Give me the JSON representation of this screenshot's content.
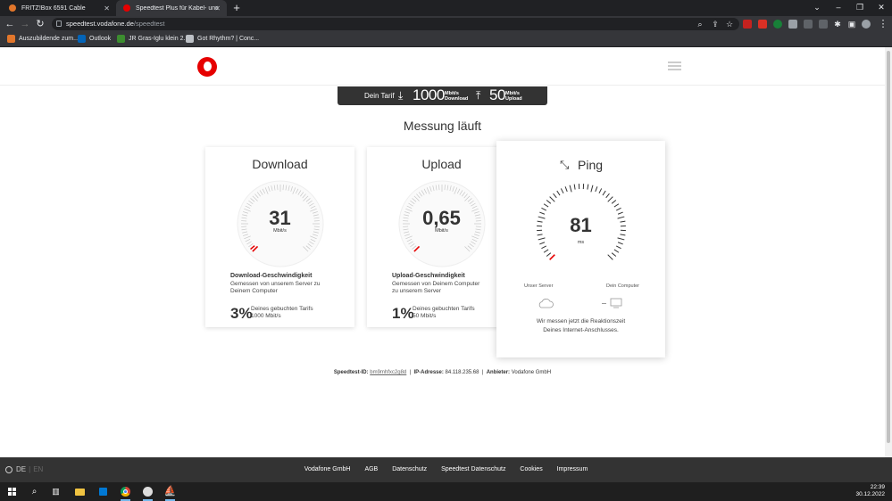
{
  "browser": {
    "tabs": [
      {
        "title": "FRITZ!Box 6591 Cable"
      },
      {
        "title": "Speedtest Plus für Kabel- und DS"
      }
    ],
    "url_host": "speedtest.vodafone.de",
    "url_path": "/speedtest",
    "bookmarks": [
      {
        "label": "Auszubildende zum..."
      },
      {
        "label": "Outlook"
      },
      {
        "label": "JR Gras-Iglu klein 2..."
      },
      {
        "label": "Got Rhythm? | Conc..."
      }
    ]
  },
  "tarif": {
    "label": "Dein Tarif",
    "download_value": "1000",
    "download_unit_1": "Mbit/s",
    "download_unit_2": "Download",
    "upload_value": "50",
    "upload_unit_1": "Mbit/s",
    "upload_unit_2": "Upload"
  },
  "status_text": "Messung läuft",
  "download": {
    "title": "Download",
    "value": "31",
    "unit": "Mbit/s",
    "desc_title": "Download-Geschwindigkeit",
    "desc_text": "Gemessen von unserem Server zu Deinem Computer",
    "percent": "3%",
    "pct_line1": "Deines gebuchten Tarifs",
    "pct_line2": "1000 Mbit/s",
    "fraction": 0.03
  },
  "upload": {
    "title": "Upload",
    "value": "0,65",
    "unit": "Mbit/s",
    "desc_title": "Upload-Geschwindigkeit",
    "desc_text": "Gemessen von Deinem Computer zu unserem Server",
    "percent": "1%",
    "pct_line1": "Deines gebuchten Tarifs",
    "pct_line2": "50 Mbit/s",
    "fraction": 0.01
  },
  "ping": {
    "title": "Ping",
    "value": "81",
    "unit": "ms",
    "server_label": "Unser Server",
    "computer_label": "Dein Computer",
    "desc_line1": "Wir messen jetzt die Reaktionszeit",
    "desc_line2": "Deines Internet-Anschlusses."
  },
  "info": {
    "id_label": "Speedtest-ID:",
    "id_value": "bm9mhfxc2g8d",
    "ip_label": "IP-Adresse:",
    "ip_value": "84.118.235.68",
    "provider_label": "Anbieter:",
    "provider_value": "Vodafone GmbH"
  },
  "footer": {
    "lang_active": "DE",
    "lang_inactive": "EN",
    "links": [
      "Vodafone GmbH",
      "AGB",
      "Datenschutz",
      "Speedtest Datenschutz",
      "Cookies",
      "Impressum"
    ]
  },
  "taskbar": {
    "time": "22:39",
    "date": "30.12.2022"
  },
  "colors": {
    "brand_red": "#e60000",
    "dark": "#333333"
  }
}
